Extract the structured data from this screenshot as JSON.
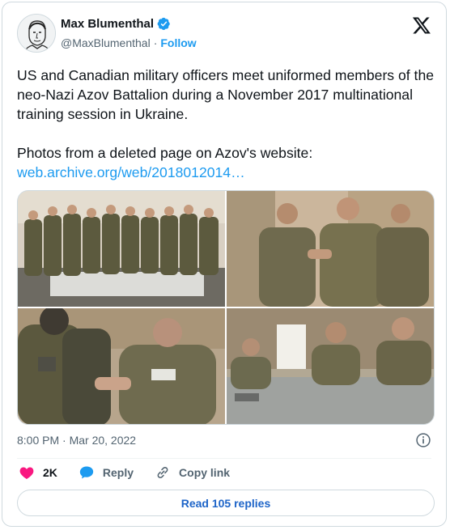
{
  "author": {
    "name": "Max Blumenthal",
    "handle": "@MaxBlumenthal",
    "separator": "·",
    "follow_label": "Follow"
  },
  "tweet": {
    "line1": "US and Canadian military officers meet uniformed members of the neo-Nazi Azov Battalion during a November 2017 multinational training session in Ukraine.",
    "line2": "Photos from a deleted page on Azov's website:",
    "link": "web.archive.org/web/2018012014…"
  },
  "timestamp": "8:00 PM · Mar 20, 2022",
  "actions": {
    "likes": "2K",
    "reply_label": "Reply",
    "copy_label": "Copy link"
  },
  "read_replies_label": "Read 105 replies",
  "colors": {
    "accent": "#1d9bf0",
    "heart": "#f91880",
    "text": "#0f1419",
    "muted": "#536471",
    "border": "#cfd9de"
  },
  "icons": [
    "verified-badge-icon",
    "x-logo-icon",
    "info-icon",
    "heart-icon",
    "reply-bubble-icon",
    "copy-link-icon"
  ]
}
